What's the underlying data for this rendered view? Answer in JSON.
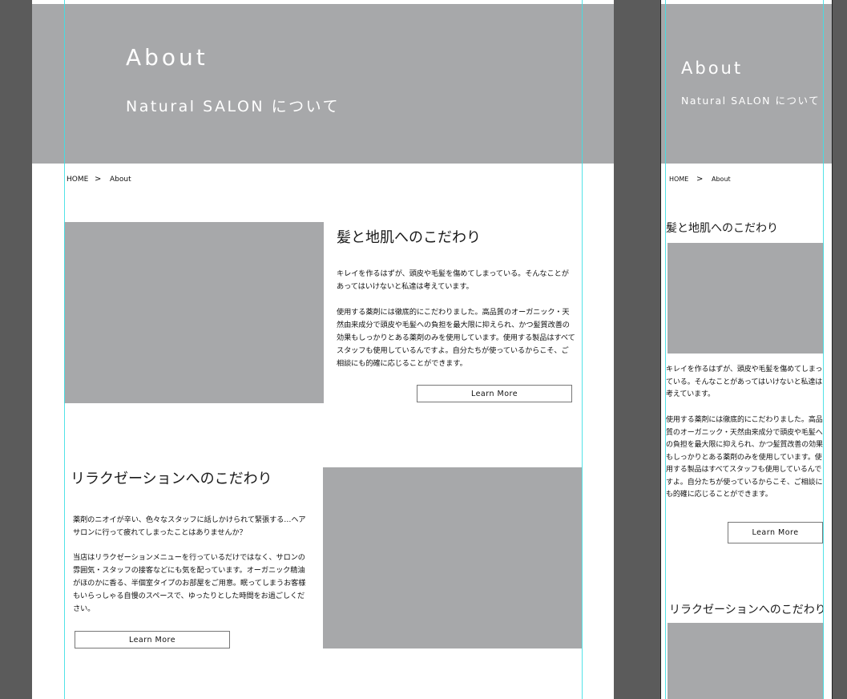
{
  "hero": {
    "title": "About",
    "subtitle": "Natural SALON について"
  },
  "breadcrumb": {
    "home": "HOME",
    "separator": ">",
    "current": "About"
  },
  "sections": [
    {
      "heading": "髪と地肌へのこだわり",
      "paragraph1": "キレイを作るはずが、頭皮や毛髪を傷めてしまっている。そんなことがあってはいけないと私達は考えています。",
      "paragraph2": "使用する薬剤には徹底的にこだわりました。高品質のオーガニック・天然由来成分で頭皮や毛髪への負担を最大限に抑えられ、かつ髪質改善の効果もしっかりとある薬剤のみを使用しています。使用する製品はすべてスタッフも使用しているんですよ。自分たちが使っているからこそ、ご相談にも的確に応じることができます。",
      "button": "Learn More"
    },
    {
      "heading": "リラクゼーションへのこだわり",
      "paragraph1": "薬剤のニオイが辛い、色々なスタッフに話しかけられて緊張する…ヘアサロンに行って疲れてしまったことはありませんか？",
      "paragraph2": "当店はリラクゼーションメニューを行っているだけではなく、サロンの雰囲気・スタッフの接客などにも気を配っています。オーガニック精油がほのかに香る、半個室タイプのお部屋をご用意。眠ってしまうお客様もいらっしゃる自慢のスペースで、ゆったりとした時間をお過ごしください。",
      "button": "Learn More"
    }
  ],
  "colors": {
    "hero_bg": "#a7a8aa",
    "placeholder_image": "#a7a8aa",
    "guide_line": "#3fe0e6",
    "canvas_bg": "#5b5b5b"
  }
}
